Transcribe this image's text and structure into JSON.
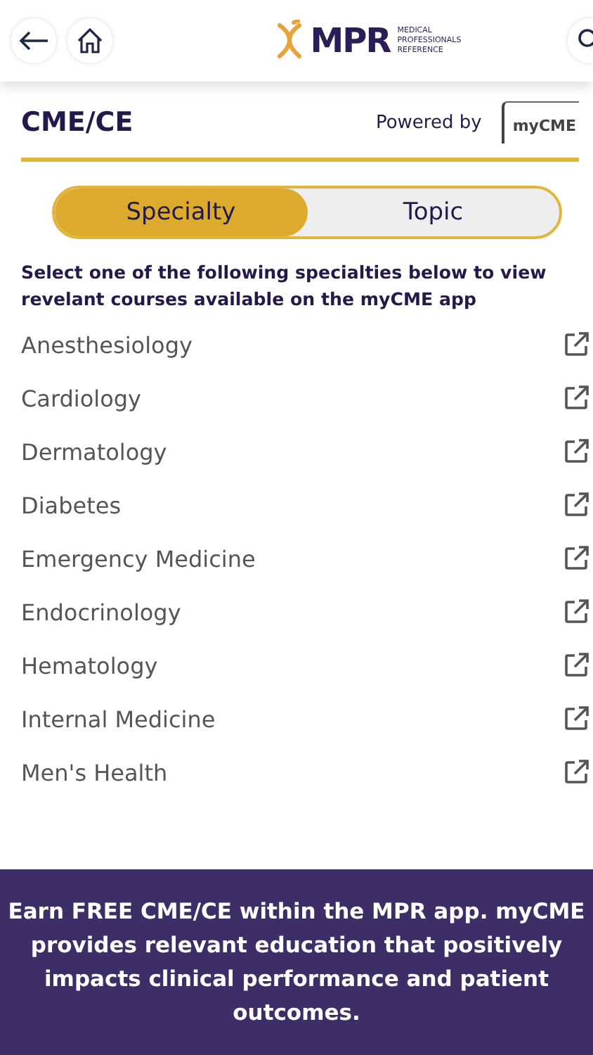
{
  "header": {
    "logo": {
      "wordmark": "MPR",
      "tagline": [
        "MEDICAL",
        "PROFESSIONALS",
        "REFERENCE"
      ]
    }
  },
  "title_bar": {
    "title": "CME/CE",
    "powered_by": "Powered by",
    "partner_logo": "myCME"
  },
  "tabs": [
    {
      "label": "Specialty",
      "selected": true
    },
    {
      "label": "Topic",
      "selected": false
    }
  ],
  "instructions": "Select one of the following specialties below to view revelant courses available on the myCME app",
  "specialties": [
    {
      "label": "Anesthesiology"
    },
    {
      "label": "Cardiology"
    },
    {
      "label": "Dermatology"
    },
    {
      "label": "Diabetes"
    },
    {
      "label": "Emergency Medicine"
    },
    {
      "label": "Endocrinology"
    },
    {
      "label": "Hematology"
    },
    {
      "label": "Internal Medicine"
    },
    {
      "label": "Men's Health"
    }
  ],
  "banner": {
    "text": "Earn FREE CME/CE within the MPR app. myCME provides relevant education that positively impacts clinical performance and patient outcomes."
  }
}
